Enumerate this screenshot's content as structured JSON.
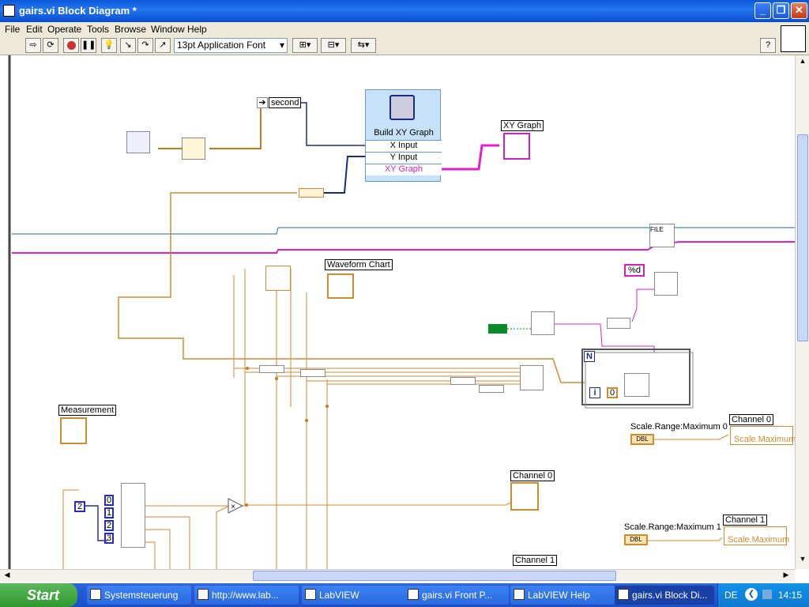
{
  "window": {
    "title": "gairs.vi Block Diagram *",
    "controls": {
      "minimize": "_",
      "maximize": "❐",
      "close": "✕"
    }
  },
  "menu": [
    "File",
    "Edit",
    "Operate",
    "Tools",
    "Browse",
    "Window",
    "Help"
  ],
  "toolbar": {
    "font": "13pt Application Font",
    "help": "?"
  },
  "diagram": {
    "labels": {
      "second": "second",
      "build_xy_title": "Build XY Graph",
      "x_input": "X Input",
      "y_input": "Y Input",
      "xy_graph_port": "XY Graph",
      "xy_graph": "XY Graph",
      "waveform_chart": "Waveform Chart",
      "measurement": "Measurement",
      "channel0_indicator": "Channel 0",
      "channel0_gauge": "Channel 0",
      "channel1_indicator": "Channel 1",
      "channel1_gauge": "Channel 1",
      "scale_max0": "Scale.Range:Maximum 0",
      "scale_max1": "Scale.Range:Maximum 1",
      "scale_maximum_a": "Scale.Maximum",
      "scale_maximum_b": "Scale.Maximum",
      "format_d": "%d",
      "file": "FILE",
      "const_2": "2",
      "idx0": "0",
      "idx1": "1",
      "idx2": "2",
      "idx3": "3",
      "loop_n": "N",
      "loop_i": "i",
      "loop_zero": "0",
      "dbl": "DBL"
    }
  },
  "taskbar": {
    "start": "Start",
    "tasks": [
      "Systemsteuerung",
      "http://www.lab...",
      "LabVIEW",
      "gairs.vi Front P...",
      "LabVIEW Help",
      "gairs.vi Block Di..."
    ],
    "lang": "DE",
    "clock": "14:15"
  }
}
